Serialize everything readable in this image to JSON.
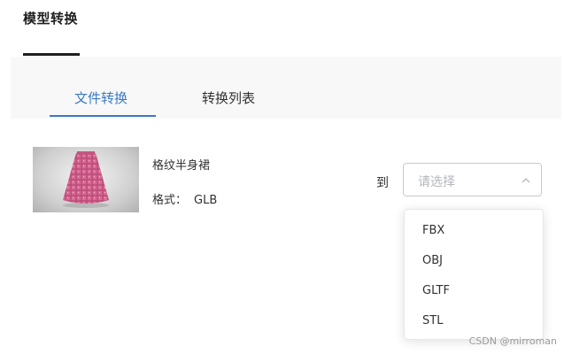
{
  "header": {
    "title": "模型转换"
  },
  "tabs": [
    {
      "label": "文件转换",
      "active": true
    },
    {
      "label": "转换列表",
      "active": false
    }
  ],
  "model": {
    "name": "格纹半身裙",
    "format_label": "格式：",
    "format_value": "GLB"
  },
  "convert": {
    "to_label": "到",
    "placeholder": "请选择",
    "options": [
      "FBX",
      "OBJ",
      "GLTF",
      "STL"
    ]
  },
  "watermark": "CSDN @mirroman",
  "colors": {
    "accent": "#3a79c7",
    "skirt": "#d96a95"
  }
}
